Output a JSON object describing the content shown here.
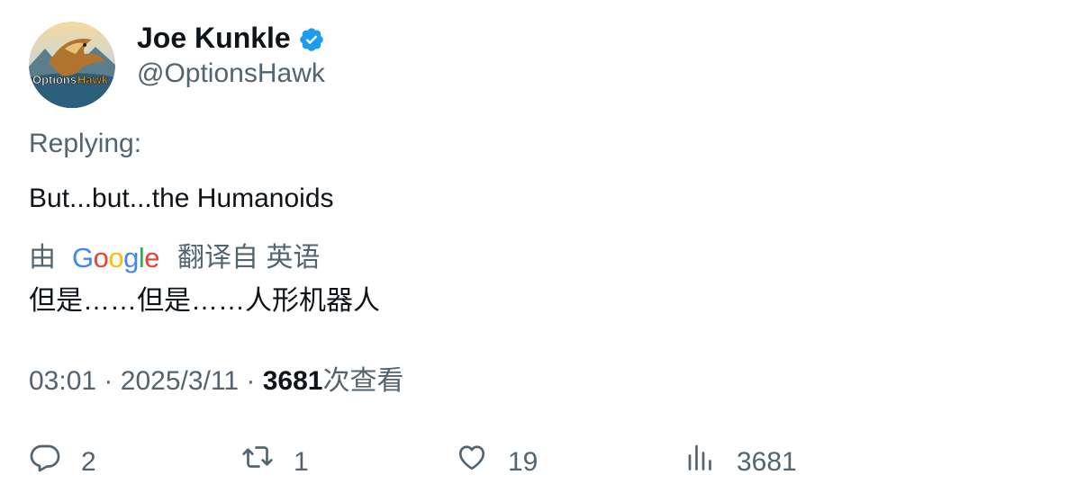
{
  "author": {
    "display_name": "Joe Kunkle",
    "handle": "@OptionsHawk",
    "verified": true,
    "avatar_text": "OptionsHawk"
  },
  "replying_label": "Replying:",
  "tweet": {
    "text": "But...but...the Humanoids"
  },
  "translation": {
    "by_label": "由",
    "google_letters": [
      "G",
      "o",
      "o",
      "g",
      "l",
      "e"
    ],
    "translated_from": "翻译自 英语",
    "text": "但是……但是……人形机器人"
  },
  "meta": {
    "time": "03:01",
    "separator": "·",
    "date": "2025/3/11",
    "views_count": "3681",
    "views_label": "次查看"
  },
  "actions": {
    "replies": "2",
    "retweets": "1",
    "likes": "19",
    "views": "3681"
  },
  "colors": {
    "verified": "#1D9BF0",
    "secondary_text": "#536471",
    "primary_text": "#0f1419"
  },
  "icons": [
    "verified-badge-icon",
    "reply-icon",
    "retweet-icon",
    "like-icon",
    "views-icon"
  ]
}
